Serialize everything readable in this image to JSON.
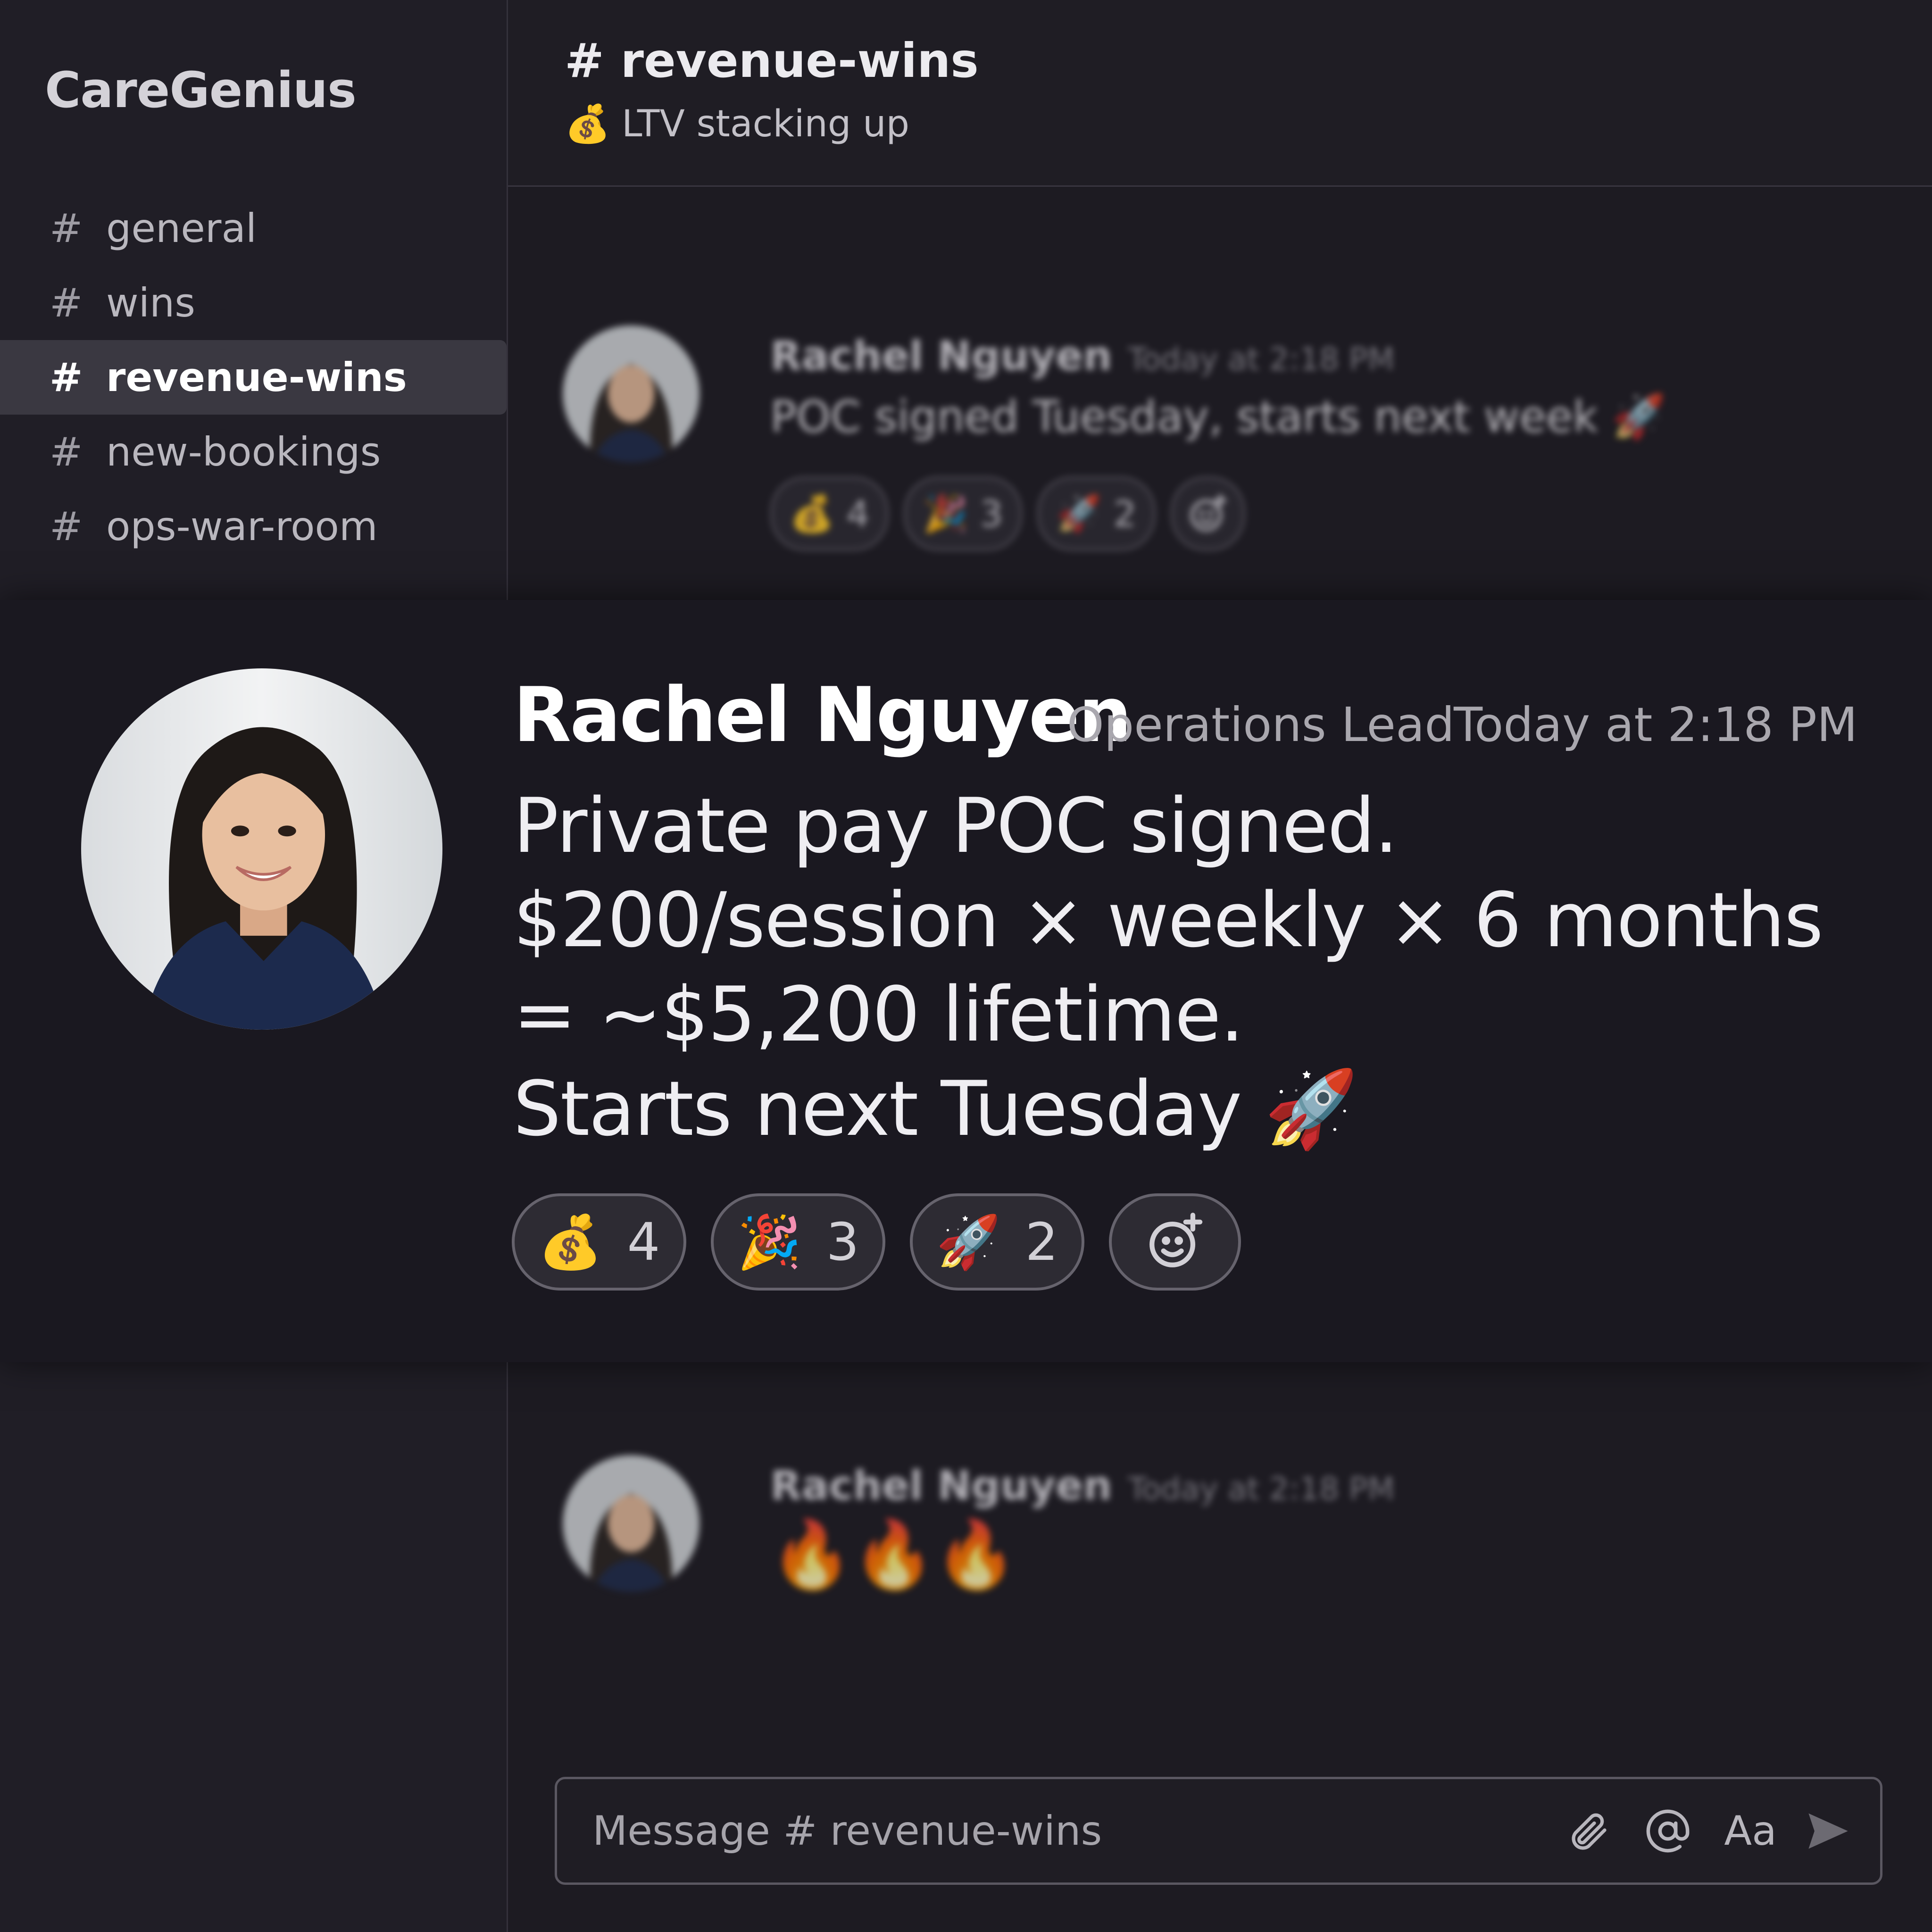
{
  "workspace": {
    "name": "CareGenius"
  },
  "sidebar": {
    "channels": [
      {
        "label": "general",
        "active": false
      },
      {
        "label": "wins",
        "active": false
      },
      {
        "label": "revenue-wins",
        "active": true
      },
      {
        "label": "new-bookings",
        "active": false
      },
      {
        "label": "ops-war-room",
        "active": false
      }
    ]
  },
  "header": {
    "title": "# revenue-wins",
    "topic": "LTV stacking up",
    "topic_icon": "money-bag-icon"
  },
  "background_messages": [
    {
      "author": "Rachel Nguyen",
      "time": "Today at 2:18 PM",
      "text": "POC signed Tuesday, starts next week 🚀",
      "reactions": [
        {
          "emoji": "💰",
          "count": "4"
        },
        {
          "emoji": "🎉",
          "count": "3"
        },
        {
          "emoji": "🚀",
          "count": "2"
        }
      ]
    },
    {
      "author": "Rachel Nguyen",
      "time": "Today at 2:18 PM",
      "text": "🔥🔥🔥"
    }
  ],
  "focused_message": {
    "author": "Rachel Nguyen",
    "role": "Operations Lead",
    "time": "Today at 2:18 PM",
    "lines": [
      "Private pay POC signed.",
      "$200/session × weekly × 6 months",
      "= ~$5,200 lifetime.",
      "Starts next Tuesday 🚀"
    ],
    "reactions": [
      {
        "emoji": "💰",
        "count": "4",
        "icon": "money-bag-icon"
      },
      {
        "emoji": "🎉",
        "count": "3",
        "icon": "party-popper-icon"
      },
      {
        "emoji": "🚀",
        "count": "2",
        "icon": "rocket-icon"
      }
    ]
  },
  "composer": {
    "placeholder": "Message # revenue-wins",
    "format_label": "Aa",
    "icons": [
      "paperclip-icon",
      "at-sign-icon",
      "format-icon",
      "send-icon"
    ]
  },
  "colors": {
    "background": "#1d1b22",
    "sidebar": "#201e26",
    "active_channel": "#3a3841",
    "focus_card": "#1a1820"
  }
}
